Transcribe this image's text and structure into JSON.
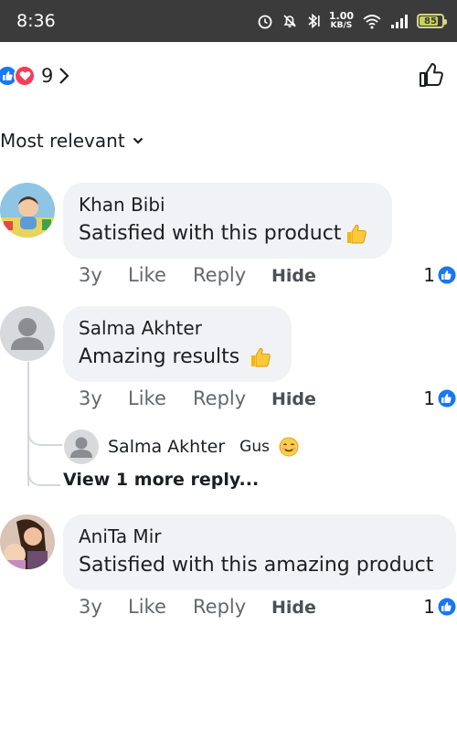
{
  "status_bar": {
    "time": "8:36",
    "net_speed_value": "1.00",
    "net_speed_unit": "KB/S",
    "battery": "85",
    "battery_level": 0.85
  },
  "reactions": {
    "count": "9"
  },
  "sort": {
    "label": "Most relevant"
  },
  "comments": [
    {
      "name": "Khan Bibi",
      "text": "Satisfied with this product",
      "time": "3y",
      "like": "Like",
      "reply": "Reply",
      "hide": "Hide",
      "likes": "1"
    },
    {
      "name": "Salma Akhter",
      "text": "Amazing results",
      "time": "3y",
      "like": "Like",
      "reply": "Reply",
      "hide": "Hide",
      "likes": "1"
    },
    {
      "name": "AniTa Mir",
      "text": "Satisfied with this amazing product",
      "time": "3y",
      "like": "Like",
      "reply": "Reply",
      "hide": "Hide",
      "likes": "1"
    }
  ],
  "reply_preview": {
    "name": "Salma Akhter",
    "text": "Gus"
  },
  "view_more": "View 1 more reply..."
}
